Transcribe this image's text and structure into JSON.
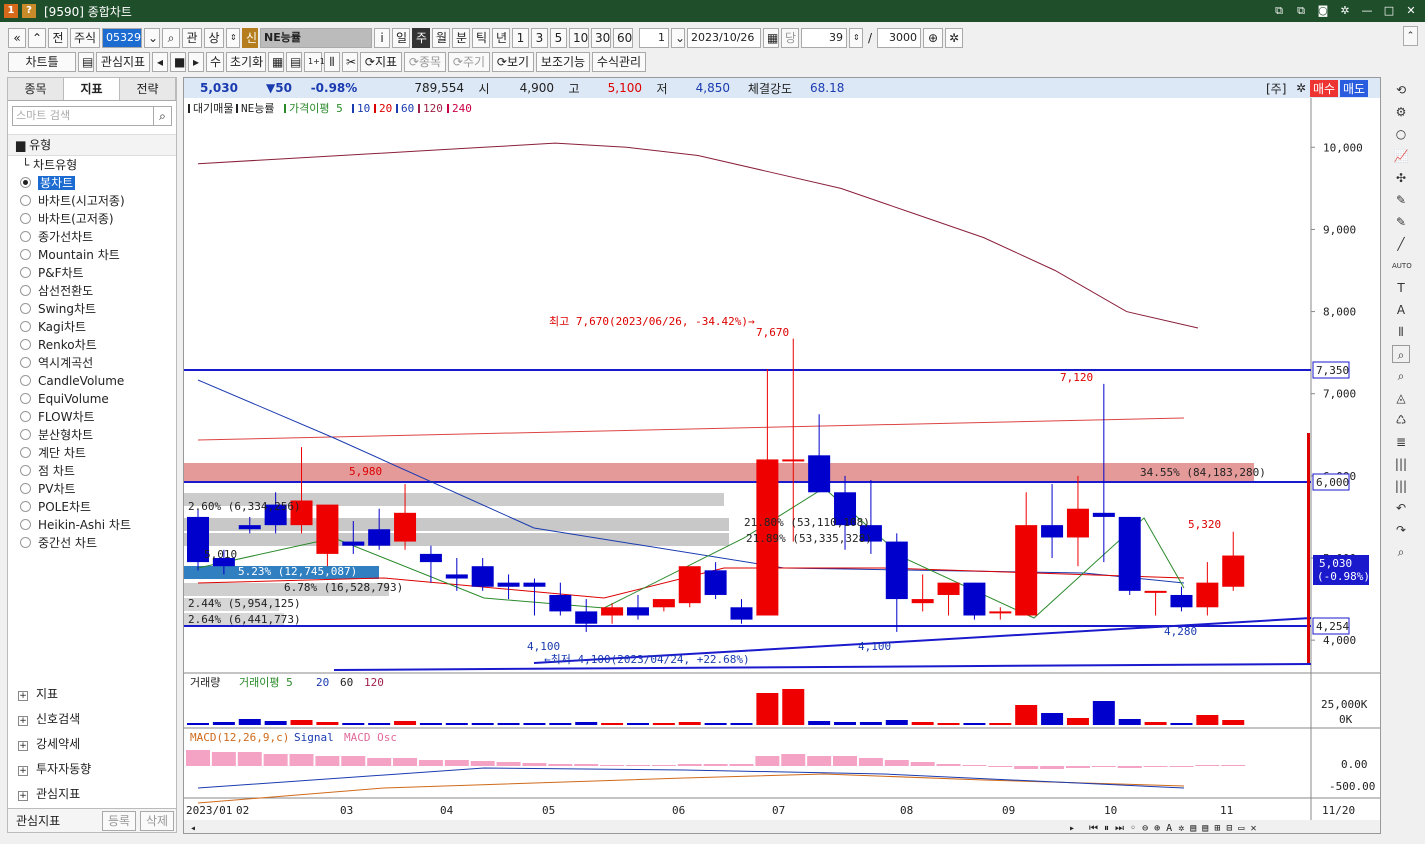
{
  "window": {
    "badge1": "1",
    "badge2": "?",
    "title": "[9590] 종합차트"
  },
  "toolbar1": {
    "nav_first": "«",
    "nav_up": "⌃",
    "prev_label": "전",
    "market_label": "주식",
    "code": "053290",
    "mgmt_label": "관",
    "up_label": "상",
    "sin_label": "신",
    "stock_name": "NE능률",
    "info_btn": "i",
    "periods": [
      "일",
      "주",
      "월",
      "분",
      "틱",
      "년"
    ],
    "active_period": "주",
    "intervals": [
      "1",
      "3",
      "5",
      "10",
      "30",
      "60"
    ],
    "count": "1",
    "date": "2023/10/26",
    "dang": "당",
    "num1": "39",
    "slash": "/",
    "num2": "3000"
  },
  "toolbar2": {
    "items": [
      "차트틀",
      "관심지표",
      "수",
      "초기화",
      "1+1",
      "⟳지표",
      "⟳종목",
      "⟳주기",
      "⟳보기",
      "보조기능",
      "수식관리"
    ]
  },
  "left_panel": {
    "tabs": [
      "종목",
      "지표",
      "전략"
    ],
    "active_tab": "지표",
    "search_placeholder": "스마트 검색",
    "section_title": "유형",
    "group_title": "차트유형",
    "chart_types": [
      "봉차트",
      "바차트(시고저종)",
      "바차트(고저종)",
      "종가선차트",
      "Mountain 차트",
      "P&F차트",
      "삼선전환도",
      "Swing차트",
      "Kagi차트",
      "Renko차트",
      "역시계곡선",
      "CandleVolume",
      "EquiVolume",
      "FLOW차트",
      "분산형차트",
      "계단 차트",
      "점 차트",
      "PV차트",
      "POLE차트",
      "Heikin-Ashi 차트",
      "중간선 차트"
    ],
    "selected_type": "봉차트",
    "sections": [
      "지표",
      "신호검색",
      "강세약세",
      "투자자동향",
      "관심지표"
    ],
    "footer_label": "관심지표",
    "register": "등록",
    "delete": "삭제"
  },
  "info_bar": {
    "price": "5,030",
    "change": "▼50",
    "change_pct": "-0.98%",
    "volume": "789,554",
    "open_label": "시",
    "open": "4,900",
    "high_label": "고",
    "high": "5,100",
    "low_label": "저",
    "low": "4,850",
    "strength_label": "체결강도",
    "strength": "68.18",
    "ju": "[주]",
    "buy": "매수",
    "sell": "매도"
  },
  "legend_main": {
    "items": [
      "대기매물",
      "NE능률",
      "가격이평 5",
      "10",
      "20",
      "60",
      "120",
      "240"
    ]
  },
  "legend_volume": {
    "items": [
      "거래량",
      "거래이평 5",
      "20",
      "60",
      "120"
    ]
  },
  "legend_macd": {
    "items": [
      "MACD(12,26,9,c)",
      "Signal",
      "MACD Osc"
    ]
  },
  "annotations": {
    "max_label": "최고 7,670(2023/06/26, -34.42%)→",
    "max_val": "7,670",
    "min_label": "←최저 4,100(2023/04/24, +22.68%)",
    "h7120": "7,120",
    "v5980": "5,980",
    "v5320": "5,320",
    "v4100a": "4,100",
    "v4100b": "4,100",
    "v4280": "4,280",
    "band": "34.55% (84,183,280)",
    "vp": [
      "2.60% (6,334,256)",
      "21.80% (53,110,108)",
      "21.89% (53,335,328)",
      "5.23% (12,745,087)",
      "6.78% (16,528,793)",
      "2.44% (5,954,125)",
      "2.64% (6,441,773)"
    ],
    "v5010": "5,010"
  },
  "price_axis": {
    "ticks": [
      "10,000",
      "9,000",
      "8,000",
      "7,000",
      "6,000",
      "5,000",
      "4,000"
    ],
    "mark_7350": "7,350",
    "mark_6000": "6,000",
    "mark_4254": "4,254",
    "current": "5,030",
    "current_pct": "(-0.98%)"
  },
  "vol_axis": {
    "ticks": [
      "25,000K",
      "0K"
    ]
  },
  "macd_axis": {
    "ticks": [
      "0.00",
      "-500.00"
    ]
  },
  "x_axis": {
    "labels": [
      "2023/01",
      "02",
      "03",
      "04",
      "05",
      "06",
      "07",
      "08",
      "09",
      "10",
      "11",
      "11/20"
    ]
  },
  "chart_data": {
    "type": "candlestick",
    "x": [
      "2023/01/02",
      "2023/01/09",
      "2023/01/16",
      "2023/01/30",
      "2023/02/06",
      "2023/02/13",
      "2023/02/20",
      "2023/02/27",
      "2023/03/06",
      "2023/03/13",
      "2023/03/20",
      "2023/03/27",
      "2023/04/03",
      "2023/04/10",
      "2023/04/17",
      "2023/04/24",
      "2023/05/01",
      "2023/05/08",
      "2023/05/15",
      "2023/05/22",
      "2023/05/29",
      "2023/06/05",
      "2023/06/12",
      "2023/06/19",
      "2023/06/26",
      "2023/07/03",
      "2023/07/10",
      "2023/07/17",
      "2023/07/24",
      "2023/07/31",
      "2023/08/07",
      "2023/08/14",
      "2023/08/21",
      "2023/08/28",
      "2023/09/04",
      "2023/09/11",
      "2023/09/18",
      "2023/09/25",
      "2023/10/02",
      "2023/10/09",
      "2023/10/16",
      "2023/10/23"
    ],
    "candles": [
      [
        5500,
        5600,
        4950,
        4850
      ],
      [
        5000,
        5100,
        4900,
        4800
      ],
      [
        5400,
        5500,
        5350,
        5300
      ],
      [
        5650,
        5800,
        5400,
        5300
      ],
      [
        5400,
        6350,
        5700,
        5300
      ],
      [
        5050,
        5400,
        5650,
        4900
      ],
      [
        5200,
        5450,
        5150,
        5050
      ],
      [
        5350,
        5600,
        5150,
        5100
      ],
      [
        5200,
        5900,
        5550,
        5100
      ],
      [
        5050,
        5150,
        4950,
        4700
      ],
      [
        4800,
        5000,
        4750,
        4600
      ],
      [
        4900,
        5000,
        4650,
        4600
      ],
      [
        4700,
        4800,
        4650,
        4500
      ],
      [
        4700,
        4750,
        4650,
        4300
      ],
      [
        4550,
        4700,
        4350,
        4300
      ],
      [
        4350,
        4500,
        4200,
        4100
      ],
      [
        4300,
        4450,
        4400,
        4200
      ],
      [
        4400,
        4550,
        4300,
        4250
      ],
      [
        4400,
        4500,
        4500,
        4350
      ],
      [
        4450,
        4750,
        4900,
        4400
      ],
      [
        4850,
        4950,
        4550,
        4500
      ],
      [
        4400,
        4500,
        4250,
        4200
      ],
      [
        4300,
        7300,
        6200,
        4300
      ],
      [
        6200,
        7670,
        6200,
        5200
      ],
      [
        6250,
        6750,
        5800,
        5800
      ],
      [
        5800,
        6000,
        5400,
        5100
      ],
      [
        5400,
        5950,
        5200,
        5050
      ],
      [
        5200,
        5300,
        4500,
        4100
      ],
      [
        4450,
        4800,
        4500,
        4350
      ],
      [
        4550,
        4650,
        4700,
        4300
      ],
      [
        4700,
        4700,
        4300,
        4250
      ],
      [
        4350,
        4400,
        4350,
        4250
      ],
      [
        4300,
        5800,
        5400,
        4300
      ],
      [
        5400,
        5900,
        5250,
        5000
      ],
      [
        5250,
        6000,
        5600,
        4900
      ],
      [
        5550,
        7120,
        5500,
        4950
      ],
      [
        5500,
        5500,
        4600,
        4550
      ],
      [
        4600,
        4600,
        4600,
        4300
      ],
      [
        4550,
        4650,
        4400,
        4350
      ],
      [
        4400,
        4950,
        4700,
        4300
      ],
      [
        4650,
        5320,
        5030,
        4600
      ]
    ],
    "series_order": [
      "open",
      "high",
      "close",
      "low"
    ],
    "ma240": [
      9800,
      9850,
      9900,
      9950,
      10000,
      10050,
      10000,
      9900,
      9700,
      9500,
      9200,
      8900,
      8500,
      8000,
      7800
    ],
    "ylim": [
      3600,
      10600
    ]
  }
}
